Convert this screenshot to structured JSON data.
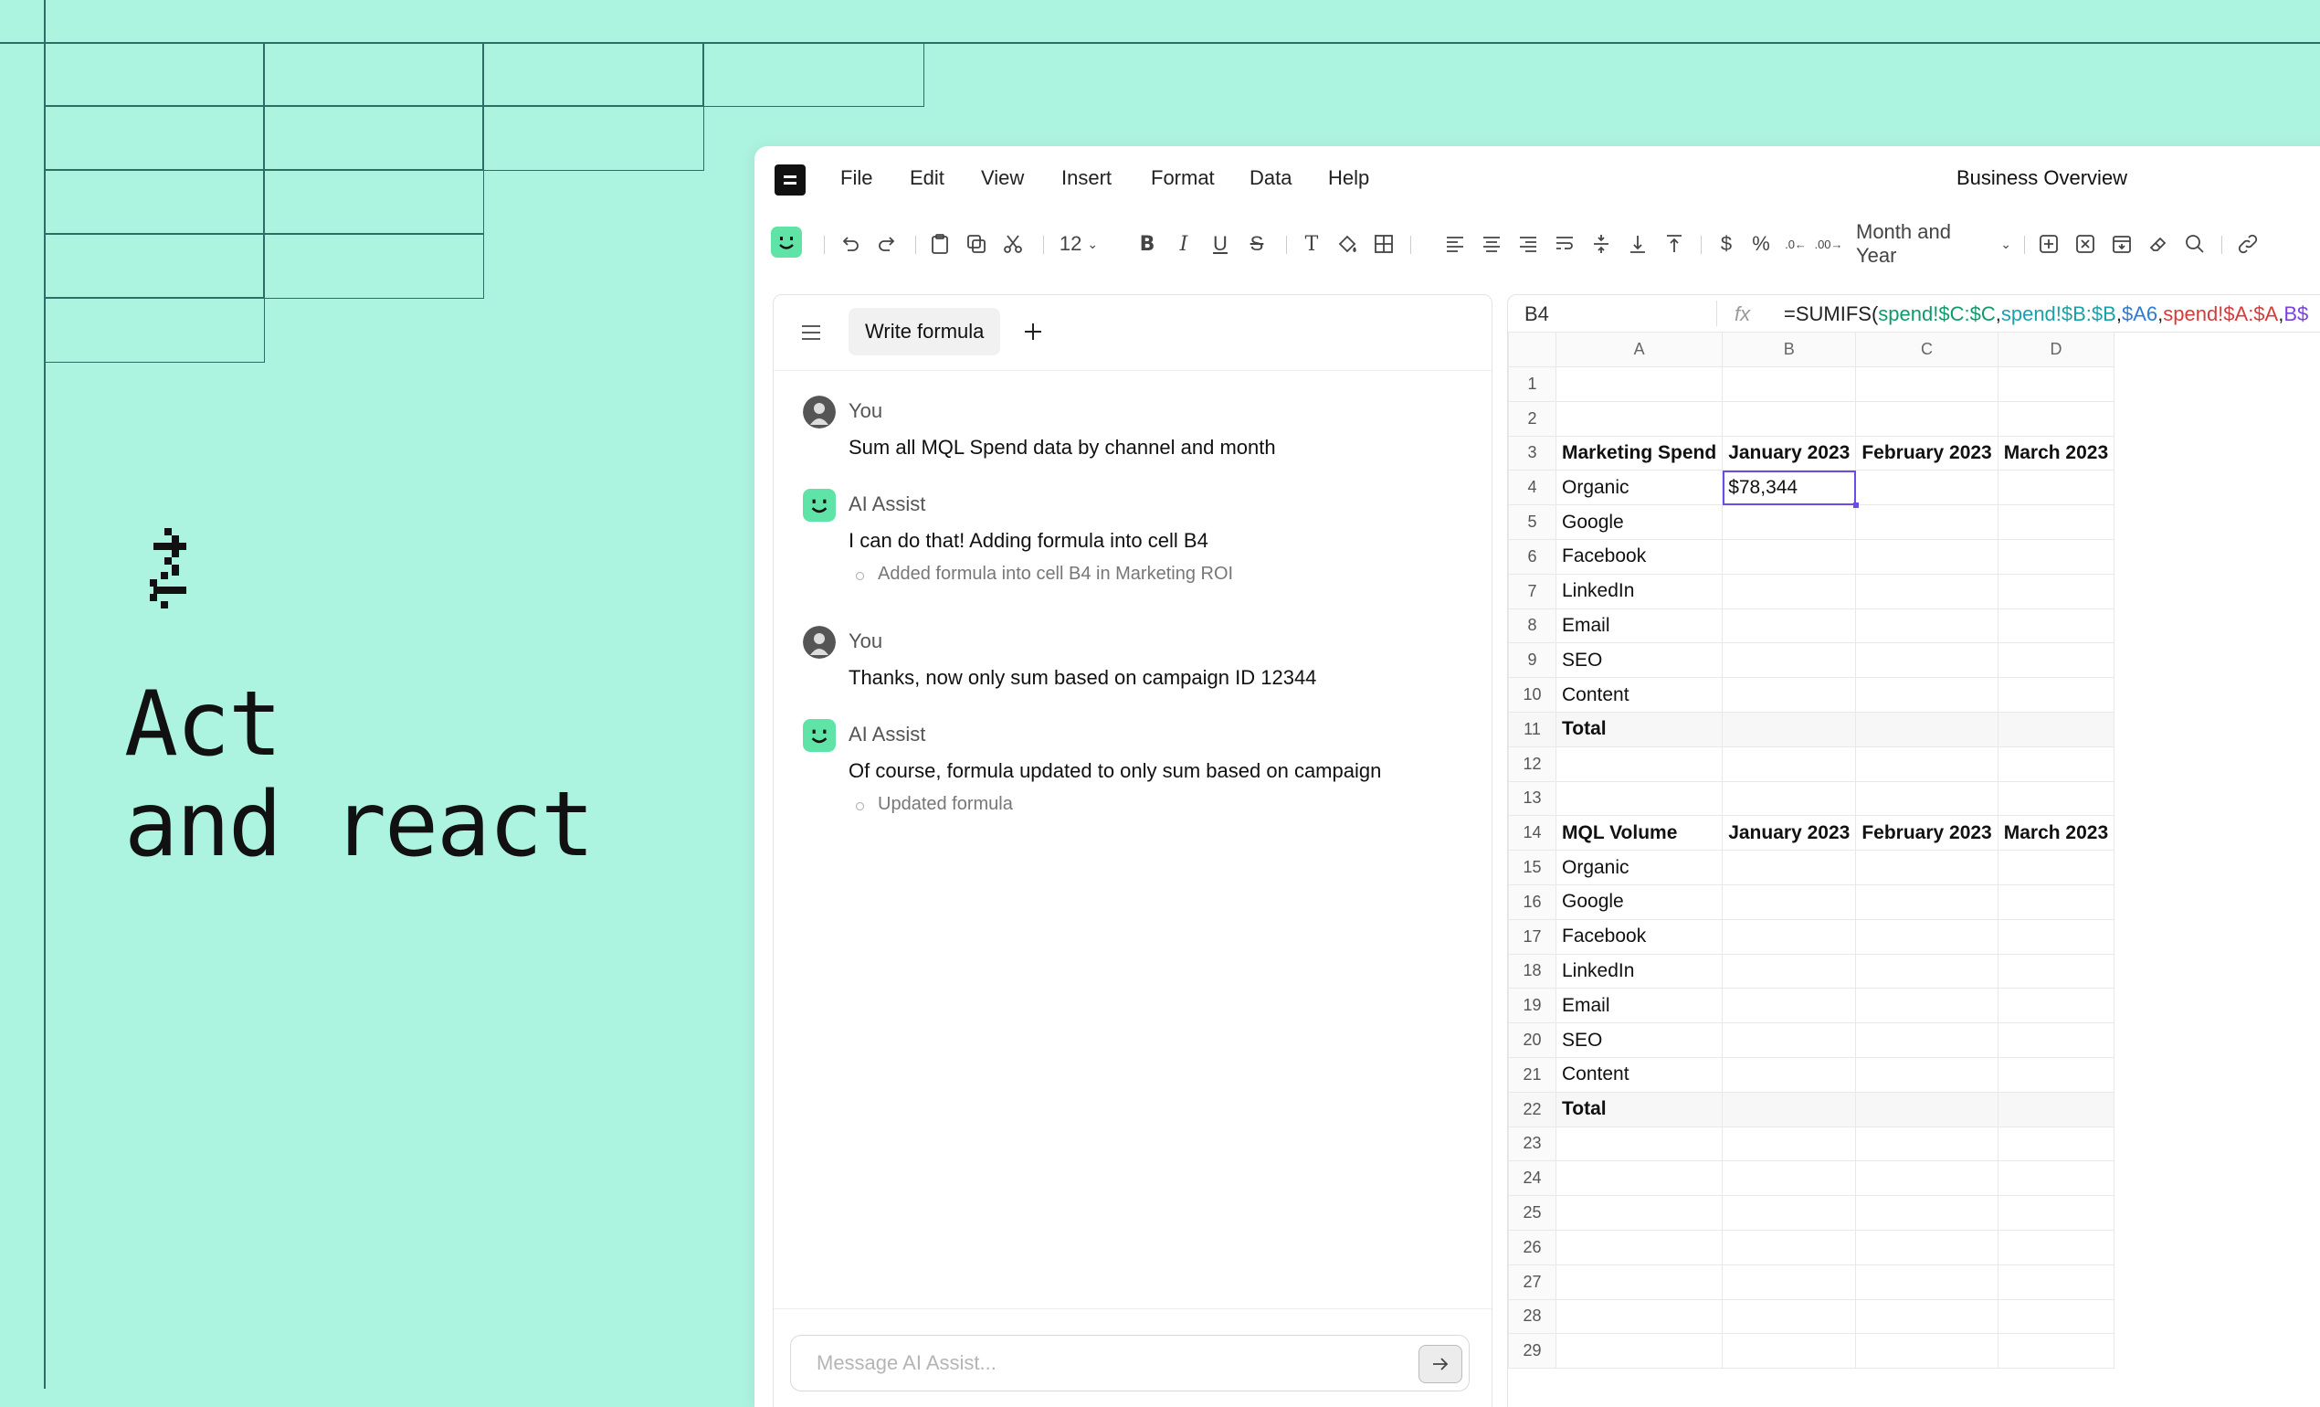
{
  "hero": {
    "line1": "Act",
    "line2": "and react"
  },
  "menu": {
    "items": [
      "File",
      "Edit",
      "View",
      "Insert",
      "Format",
      "Data",
      "Help"
    ]
  },
  "doc_title": "Business Overview",
  "toolbar": {
    "font_size": "12",
    "date_format": "Month and Year"
  },
  "chat": {
    "tab_label": "Write formula",
    "messages": [
      {
        "author": "You",
        "text": "Sum all MQL Spend data by channel and month",
        "sub": ""
      },
      {
        "author": "AI Assist",
        "text": "I can do that! Adding formula into cell B4",
        "sub": "Added formula into cell B4 in  Marketing ROI"
      },
      {
        "author": "You",
        "text": "Thanks, now only sum based on campaign ID 12344",
        "sub": ""
      },
      {
        "author": "AI Assist",
        "text": "Of course, formula updated to only sum based on campaign",
        "sub": "Updated formula"
      }
    ],
    "input_placeholder": "Message AI Assist..."
  },
  "sheet": {
    "name_box": "B4",
    "fx": "fx",
    "formula": {
      "prefix": "=SUMIFS(",
      "arg1": "spend!$C:$C",
      "arg2": "spend!$B:$B",
      "arg3": "$A6",
      "arg4": "spend!$A:$A",
      "arg5": "B$",
      "comma": ","
    },
    "columns": [
      "A",
      "B",
      "C",
      "D"
    ],
    "rows": [
      {
        "n": "1",
        "cells": [
          "",
          "",
          "",
          ""
        ]
      },
      {
        "n": "2",
        "cells": [
          "",
          "",
          "",
          ""
        ]
      },
      {
        "n": "3",
        "cells": [
          "Marketing Spend",
          "January 2023",
          "February 2023",
          "March 2023"
        ]
      },
      {
        "n": "4",
        "cells": [
          "Organic",
          "$78,344",
          "",
          ""
        ]
      },
      {
        "n": "5",
        "cells": [
          "Google",
          "",
          "",
          ""
        ]
      },
      {
        "n": "6",
        "cells": [
          "Facebook",
          "",
          "",
          ""
        ]
      },
      {
        "n": "7",
        "cells": [
          "LinkedIn",
          "",
          "",
          ""
        ]
      },
      {
        "n": "8",
        "cells": [
          "Email",
          "",
          "",
          ""
        ]
      },
      {
        "n": "9",
        "cells": [
          "SEO",
          "",
          "",
          ""
        ]
      },
      {
        "n": "10",
        "cells": [
          "Content",
          "",
          "",
          ""
        ]
      },
      {
        "n": "11",
        "cells": [
          "Total",
          "",
          "",
          ""
        ]
      },
      {
        "n": "12",
        "cells": [
          "",
          "",
          "",
          ""
        ]
      },
      {
        "n": "13",
        "cells": [
          "",
          "",
          "",
          ""
        ]
      },
      {
        "n": "14",
        "cells": [
          "MQL Volume",
          "January 2023",
          "February 2023",
          "March 2023"
        ]
      },
      {
        "n": "15",
        "cells": [
          "Organic",
          "",
          "",
          ""
        ]
      },
      {
        "n": "16",
        "cells": [
          "Google",
          "",
          "",
          ""
        ]
      },
      {
        "n": "17",
        "cells": [
          "Facebook",
          "",
          "",
          ""
        ]
      },
      {
        "n": "18",
        "cells": [
          "LinkedIn",
          "",
          "",
          ""
        ]
      },
      {
        "n": "19",
        "cells": [
          "Email",
          "",
          "",
          ""
        ]
      },
      {
        "n": "20",
        "cells": [
          "SEO",
          "",
          "",
          ""
        ]
      },
      {
        "n": "21",
        "cells": [
          "Content",
          "",
          "",
          ""
        ]
      },
      {
        "n": "22",
        "cells": [
          "Total",
          "",
          "",
          ""
        ]
      },
      {
        "n": "23",
        "cells": [
          "",
          "",
          "",
          ""
        ]
      },
      {
        "n": "24",
        "cells": [
          "",
          "",
          "",
          ""
        ]
      },
      {
        "n": "25",
        "cells": [
          "",
          "",
          "",
          ""
        ]
      },
      {
        "n": "26",
        "cells": [
          "",
          "",
          "",
          ""
        ]
      },
      {
        "n": "27",
        "cells": [
          "",
          "",
          "",
          ""
        ]
      },
      {
        "n": "28",
        "cells": [
          "",
          "",
          "",
          ""
        ]
      },
      {
        "n": "29",
        "cells": [
          "",
          "",
          "",
          ""
        ]
      }
    ],
    "bold_rows": [
      "3",
      "11",
      "14",
      "22"
    ],
    "total_rows": [
      "11",
      "22"
    ],
    "selected": {
      "row": "4",
      "col": 1
    }
  },
  "colors": {
    "background": "#adf4e0",
    "accent": "#6d4be6",
    "ai_green": "#5fe3a7"
  }
}
